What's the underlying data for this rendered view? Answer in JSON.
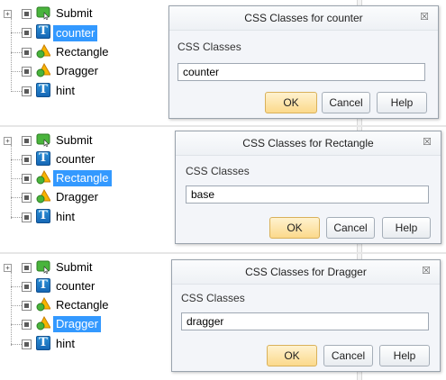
{
  "tree_labels": {
    "submit": "Submit",
    "counter": "counter",
    "rectangle": "Rectangle",
    "dragger": "Dragger",
    "hint": "hint"
  },
  "dialog_common": {
    "field_label": "CSS Classes",
    "ok_label": "OK",
    "cancel_label": "Cancel",
    "help_label": "Help",
    "close_glyph": "☒"
  },
  "panels": [
    {
      "selected": "counter",
      "dialog_title": "CSS Classes for counter",
      "input_value": "counter"
    },
    {
      "selected": "rectangle",
      "dialog_title": "CSS Classes for Rectangle",
      "input_value": "base"
    },
    {
      "selected": "dragger",
      "dialog_title": "CSS Classes for Dragger",
      "input_value": "dragger"
    }
  ],
  "colors": {
    "selection": "#3399ff",
    "ok_button": "#fbd98b",
    "dialog_bg": "#f3f5f9"
  }
}
